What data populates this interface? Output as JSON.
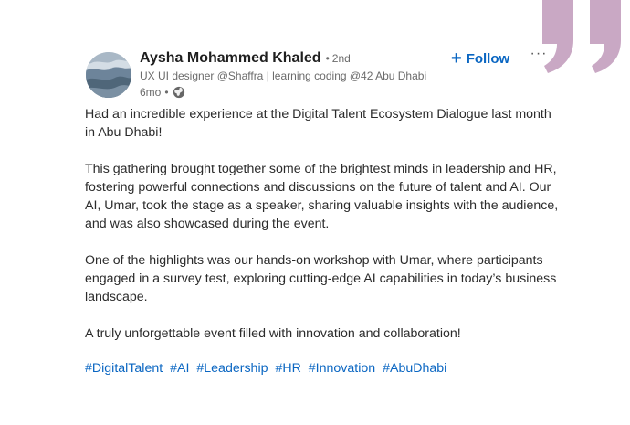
{
  "author": {
    "name": "Aysha Mohammed Khaled",
    "degree": "2nd",
    "headline": "UX UI designer @Shaffra | learning coding @42 Abu Dhabi",
    "time": "6mo",
    "avatar_icon": "avatar-photo"
  },
  "actions": {
    "follow_label": "Follow",
    "more_label": "···"
  },
  "post": {
    "paragraphs": [
      "Had an incredible experience at the Digital Talent Ecosystem Dialogue last month in Abu Dhabi!",
      "This gathering brought together some of the brightest minds in leadership and HR, fostering powerful connections and discussions on the future of talent and AI. Our AI, Umar, took the stage as a speaker, sharing valuable insights with the audience, and was also showcased during the event.",
      "One of the highlights was our hands-on workshop with Umar, where participants engaged in a survey test, exploring cutting-edge AI capabilities in today’s business landscape.",
      "A truly unforgettable event filled with innovation and collaboration!"
    ],
    "hashtags": [
      "#DigitalTalent",
      "#AI",
      "#Leadership",
      "#HR",
      "#Innovation",
      "#AbuDhabi"
    ]
  },
  "colors": {
    "accent": "#0a66c2",
    "quote_mark": "#c9a8c4",
    "text": "#2b2b2b",
    "muted": "#6b6b6b"
  },
  "icons": {
    "visibility": "globe-icon",
    "decoration": "quote-mark-icon"
  }
}
